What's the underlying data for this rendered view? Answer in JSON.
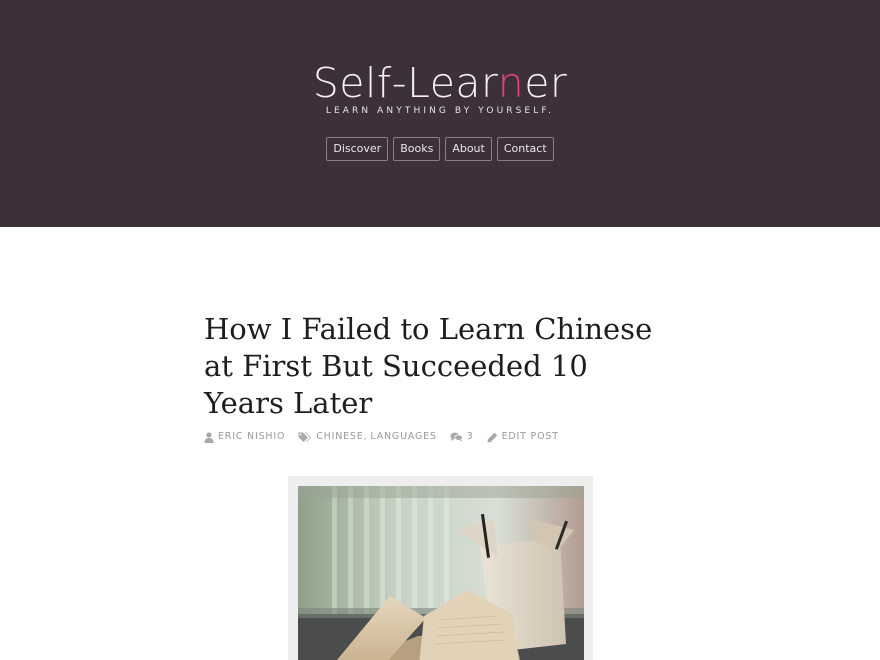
{
  "site": {
    "title_main": "Self-Lear",
    "title_accent": "n",
    "title_end": "er",
    "tagline": "LEARN ANYTHING BY YOURSELF.",
    "accent_color": "#e0447c",
    "header_color": "#3d3039"
  },
  "nav": {
    "items": [
      {
        "label": "Discover"
      },
      {
        "label": "Books"
      },
      {
        "label": "About"
      },
      {
        "label": "Contact"
      }
    ]
  },
  "post": {
    "title": "How I Failed to Learn Chinese at First But Succeeded 10 Years Later",
    "meta": {
      "author": "ERIC NISHIO",
      "categories": [
        "CHINESE",
        "LANGUAGES"
      ],
      "comment_count": "3",
      "edit_label": "EDIT POST"
    },
    "featured_image": {
      "icon": "open-book-and-takeout-box-photo"
    }
  }
}
